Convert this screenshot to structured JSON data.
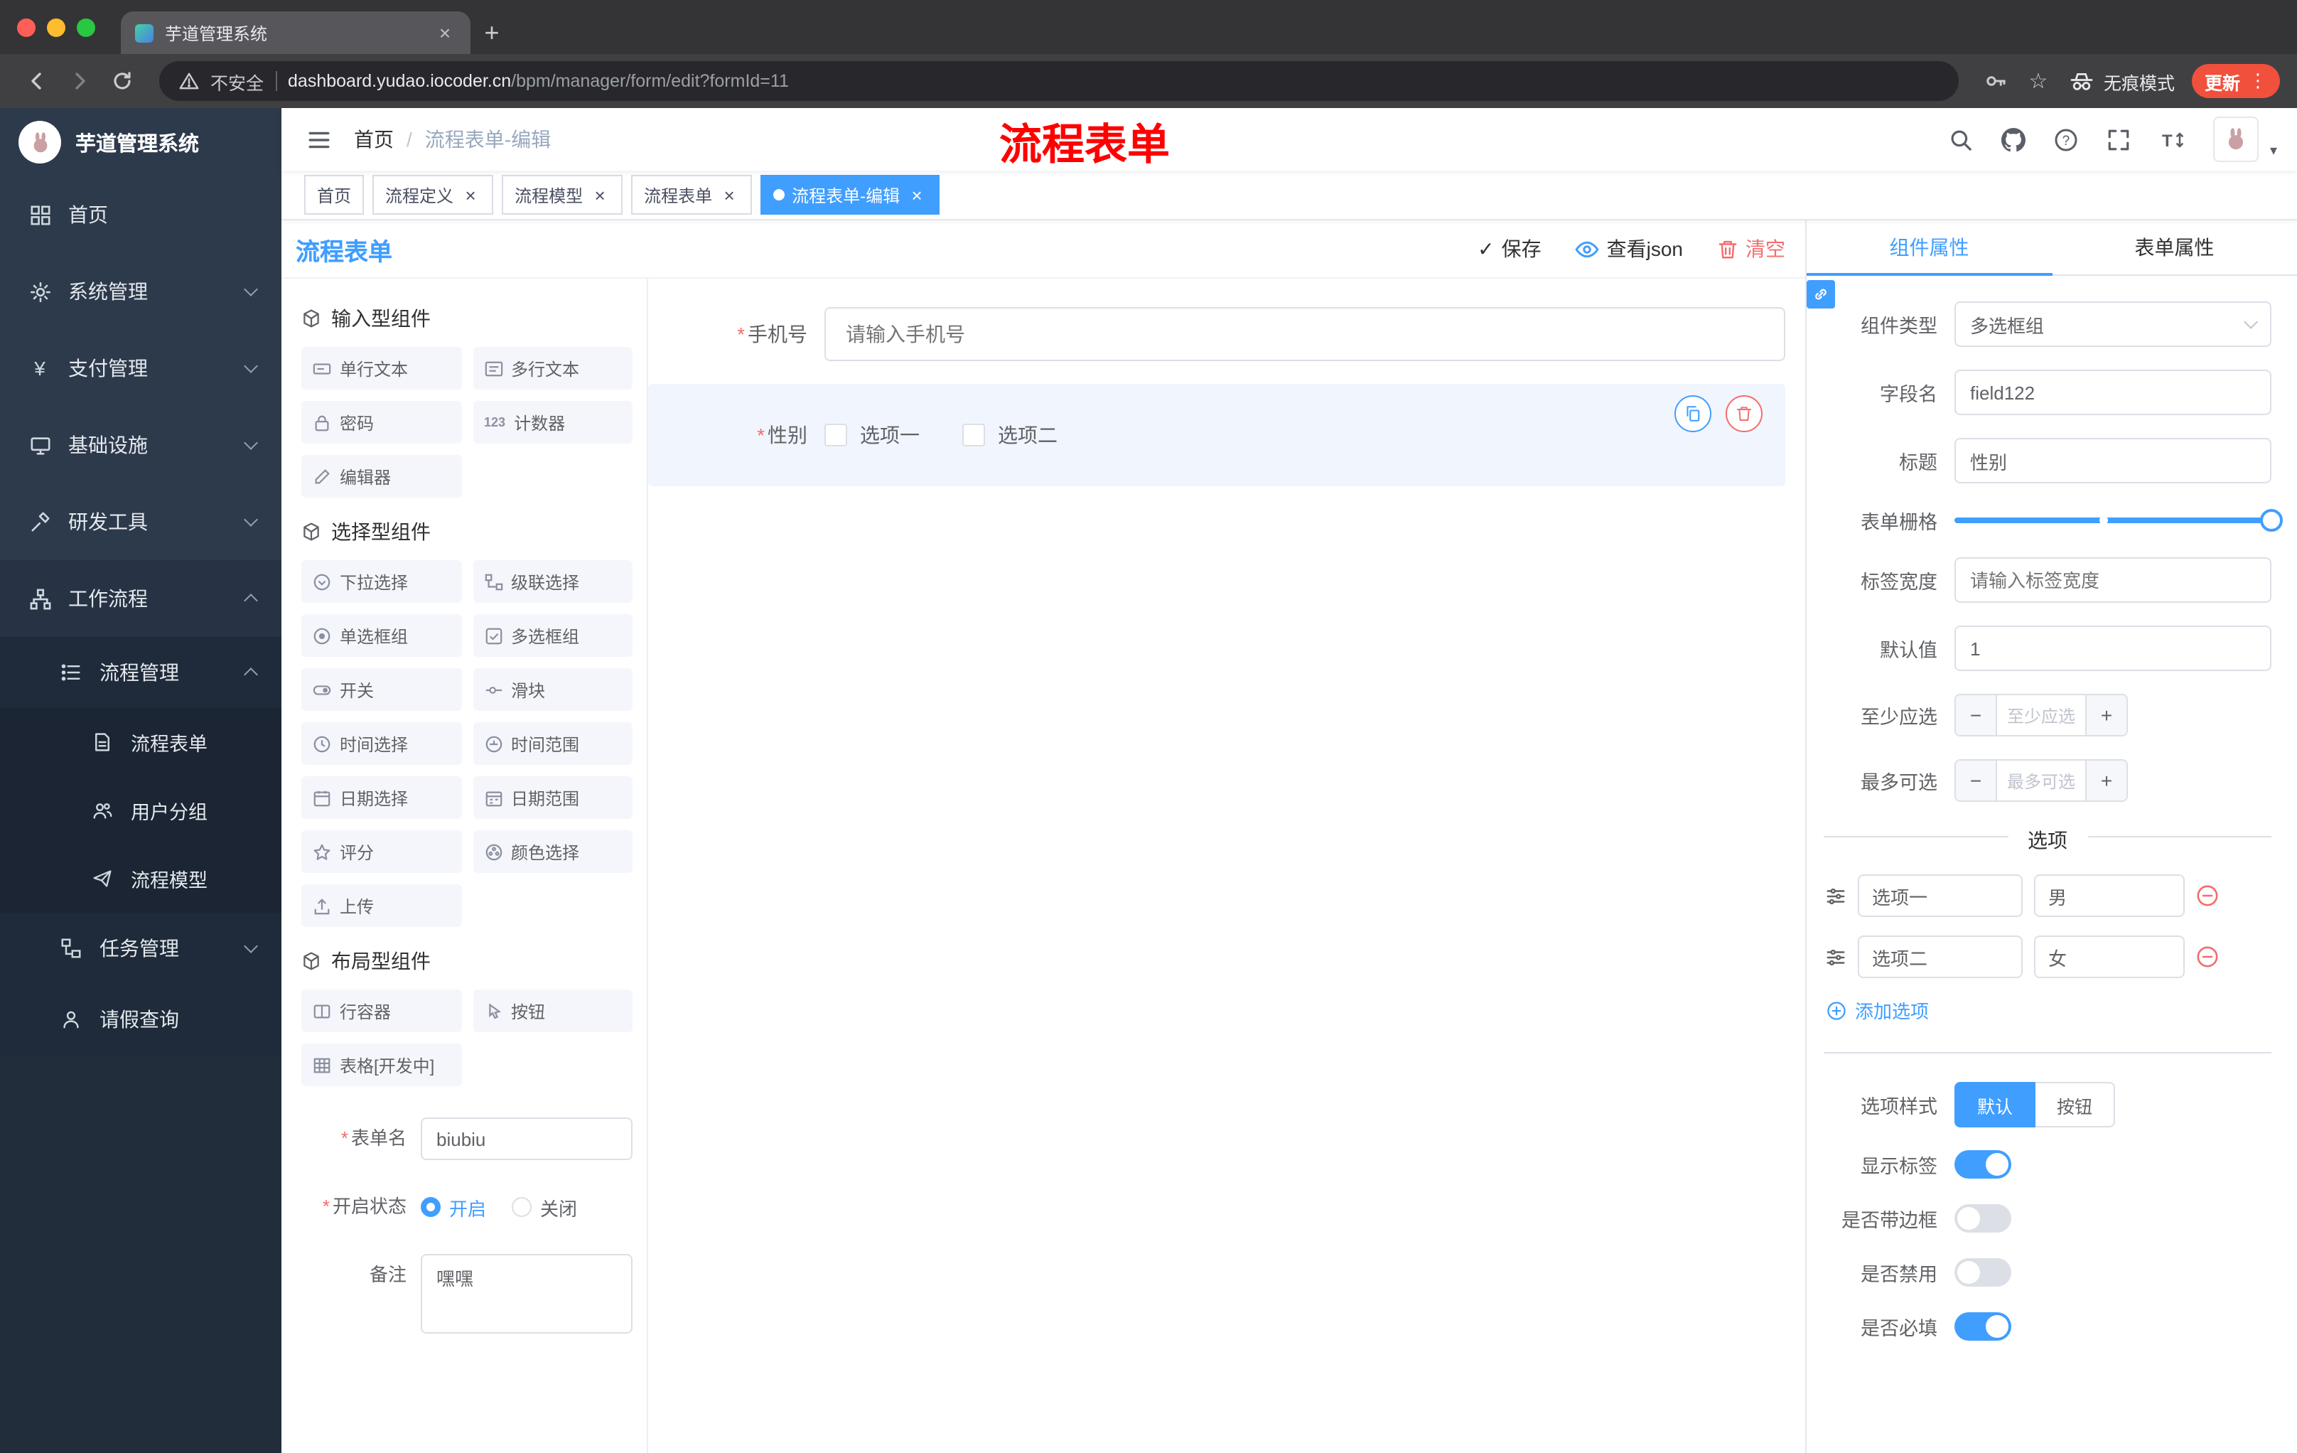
{
  "colors": {
    "accent": "#409eff",
    "danger": "#f56c6c",
    "annotation": "#ff0000"
  },
  "icons": {
    "close": "×",
    "new_tab": "+",
    "kebab": "⋮",
    "star": "☆",
    "slash": "/",
    "caret": "▾",
    "check": "✓",
    "yen": "¥",
    "counter": "123",
    "question": "?",
    "font_size": "T",
    "asterisk": "*",
    "minus": "−",
    "plus": "+"
  },
  "browser": {
    "tab_title": "芋道管理系统",
    "security_label": "不安全",
    "url_domain": "dashboard.yudao.iocoder.cn",
    "url_path": "/bpm/manager/form/edit?formId=11",
    "incognito_label": "无痕模式",
    "update_label": "更新"
  },
  "annotation": {
    "text": "流程表单"
  },
  "sidebar": {
    "logo_title": "芋道管理系统",
    "items": [
      {
        "label": "首页",
        "icon": "dashboard-icon"
      },
      {
        "label": "系统管理",
        "icon": "gear-icon",
        "chevron": "down"
      },
      {
        "label": "支付管理",
        "icon": "yen-icon",
        "chevron": "down"
      },
      {
        "label": "基础设施",
        "icon": "monitor-icon",
        "chevron": "down"
      },
      {
        "label": "研发工具",
        "icon": "tools-icon",
        "chevron": "down"
      },
      {
        "label": "工作流程",
        "icon": "workflow-icon",
        "chevron": "up",
        "expanded": true
      },
      {
        "label": "流程管理",
        "icon": "list-icon",
        "chevron": "up",
        "depth": 1,
        "expanded": true
      },
      {
        "label": "流程表单",
        "icon": "form-icon",
        "depth": 2,
        "active": true
      },
      {
        "label": "用户分组",
        "icon": "users-icon",
        "depth": 2
      },
      {
        "label": "流程模型",
        "icon": "paper-plane-icon",
        "depth": 2
      },
      {
        "label": "任务管理",
        "icon": "tasks-icon",
        "chevron": "down",
        "depth": 1
      },
      {
        "label": "请假查询",
        "icon": "user-icon",
        "depth": 1
      }
    ]
  },
  "navbar": {
    "breadcrumb": [
      "首页",
      "流程表单-编辑"
    ]
  },
  "tags_view": {
    "tabs": [
      {
        "label": "首页",
        "closable": false,
        "active": false
      },
      {
        "label": "流程定义",
        "closable": true,
        "active": false
      },
      {
        "label": "流程模型",
        "closable": true,
        "active": false
      },
      {
        "label": "流程表单",
        "closable": true,
        "active": false
      },
      {
        "label": "流程表单-编辑",
        "closable": true,
        "active": true
      }
    ]
  },
  "designer": {
    "title": "流程表单",
    "actions": {
      "save": "保存",
      "view_json": "查看json",
      "clear": "清空"
    },
    "palette": {
      "groups": [
        {
          "title": "输入型组件",
          "items": [
            {
              "label": "单行文本"
            },
            {
              "label": "多行文本"
            },
            {
              "label": "密码"
            },
            {
              "label": "计数器"
            },
            {
              "label": "编辑器"
            }
          ]
        },
        {
          "title": "选择型组件",
          "items": [
            {
              "label": "下拉选择"
            },
            {
              "label": "级联选择"
            },
            {
              "label": "单选框组"
            },
            {
              "label": "多选框组"
            },
            {
              "label": "开关"
            },
            {
              "label": "滑块"
            },
            {
              "label": "时间选择"
            },
            {
              "label": "时间范围"
            },
            {
              "label": "日期选择"
            },
            {
              "label": "日期范围"
            },
            {
              "label": "评分"
            },
            {
              "label": "颜色选择"
            },
            {
              "label": "上传"
            }
          ]
        },
        {
          "title": "布局型组件",
          "items": [
            {
              "label": "行容器"
            },
            {
              "label": "按钮"
            },
            {
              "label": "表格[开发中]"
            }
          ]
        }
      ]
    },
    "meta": {
      "form_name_label": "表单名",
      "form_name_value": "biubiu",
      "status_label": "开启状态",
      "status_on": "开启",
      "status_off": "关闭",
      "status_selected": "开启",
      "remark_label": "备注",
      "remark_value": "嘿嘿"
    },
    "canvas": {
      "field_phone": {
        "label": "手机号",
        "placeholder": "请输入手机号"
      },
      "field_gender": {
        "label": "性别",
        "option1": "选项一",
        "option2": "选项二"
      }
    }
  },
  "properties": {
    "tab_component": "组件属性",
    "tab_form": "表单属性",
    "component_type_label": "组件类型",
    "component_type_value": "多选框组",
    "field_name_label": "字段名",
    "field_name_value": "field122",
    "title_label": "标题",
    "title_value": "性别",
    "grid_label": "表单栅格",
    "label_width_label": "标签宽度",
    "label_width_placeholder": "请输入标签宽度",
    "default_label": "默认值",
    "default_value": "1",
    "min_label": "至少应选",
    "min_placeholder": "至少应选",
    "max_label": "最多可选",
    "max_placeholder": "最多可选",
    "options_title": "选项",
    "options": [
      {
        "label": "选项一",
        "value": "男"
      },
      {
        "label": "选项二",
        "value": "女"
      }
    ],
    "add_option": "添加选项",
    "style_label": "选项样式",
    "style_default": "默认",
    "style_button": "按钮",
    "style_selected": "默认",
    "switch_show_label": "显示标签",
    "switch_border": "是否带边框",
    "switch_disabled": "是否禁用",
    "switch_required": "是否必填"
  }
}
